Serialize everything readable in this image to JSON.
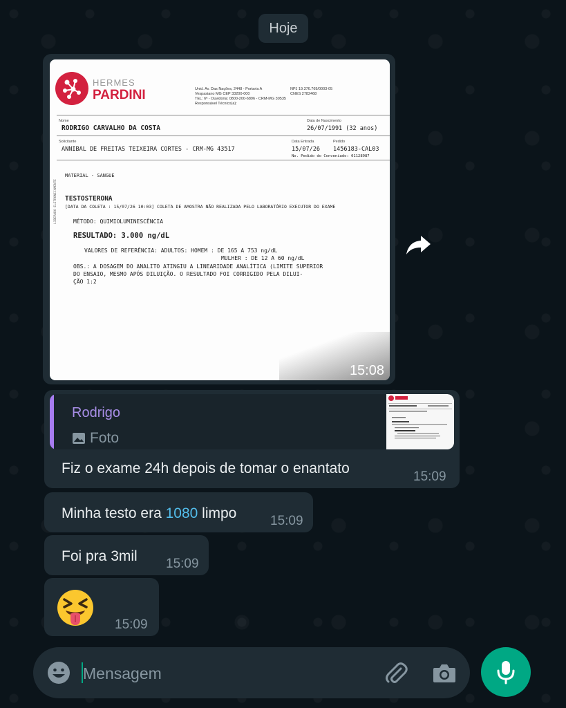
{
  "chat": {
    "date_separator": "Hoje",
    "input_placeholder": "Mensagem"
  },
  "image_message": {
    "time": "15:08",
    "document": {
      "brand_top": "HERMES",
      "brand_bottom": "PARDINI",
      "address_lines": [
        "Unid. Av. Das Nações, 2448 - Portaria A",
        "Vespasiano MG CEP 33200-000",
        "TEL: 6ª - Ouvidoria: 0800-200-6896 - CRM-MG 30535",
        "Responsável Técnico(a):"
      ],
      "cnpj_lines": [
        "NPJ 19.376.769/0003-05",
        "CNES 2782468"
      ],
      "label_nome": "Nome",
      "patient": "RODRIGO CARVALHO DA COSTA",
      "label_nascimento": "Data de Nascimento",
      "birth": "26/07/1991 (32 anos)",
      "label_solicitante": "Solicitante",
      "requester": "ANNIBAL DE FREITAS TEIXEIRA CORTES - CRM-MG 43517",
      "label_entrada": "Data Entrada",
      "entry_date": "15/07/26",
      "label_pedido": "Pedido",
      "order": "1456183-CAL03",
      "order_note": "No. Pedido do Conveniado: 01128987",
      "material": "MATERIAL - SANGUE",
      "exam": "TESTOSTERONA",
      "collection": "[DATA DA COLETA : 15/07/26    10:03] COLETA DE AMOSTRA NÃO REALIZADA PELO LABORATÓRIO EXECUTOR DO EXAME",
      "method": "MÉTODO: QUIMIOLUMINESCÊNCIA",
      "result": "RESULTADO:  3.000 ng/dL",
      "ref1": "VALORES DE REFERÊNCIA: ADULTOS: HOMEM  : DE 165 A 753 ng/dL",
      "ref2": "MULHER : DE  12 A  60 ng/dL",
      "obs1": "OBS.: A DOSAGEM DO ANALITO ATINGIU A LINEARIDADE ANALÍTICA (LIMITE SUPERIOR",
      "obs2": "DO ENSAIO, MESMO APÓS DILUIÇÃO. O RESULTADO FOI CORRIGIDO PELA DILUI-",
      "obs3": "ÇÃO 1:2"
    }
  },
  "reply_message": {
    "quoted_name": "Rodrigo",
    "quoted_type": "Foto",
    "text": "Fiz o exame 24h depois de tomar o enantato",
    "time": "15:09"
  },
  "messages": [
    {
      "text_before": "Minha testo era ",
      "highlight": "1080",
      "text_after": " limpo",
      "time": "15:09"
    },
    {
      "text": "Foi pra 3mil",
      "time": "15:09"
    },
    {
      "emoji": "😝",
      "time": "15:09"
    }
  ],
  "colors": {
    "background": "#0b141a",
    "bubble": "#1f2c34",
    "accent_green": "#00a884",
    "quote_bar": "#a77cf0",
    "link_blue": "#53bdeb"
  },
  "icons": [
    "forward-icon",
    "photo-icon",
    "emoji-icon",
    "attach-icon",
    "camera-icon",
    "mic-icon"
  ]
}
